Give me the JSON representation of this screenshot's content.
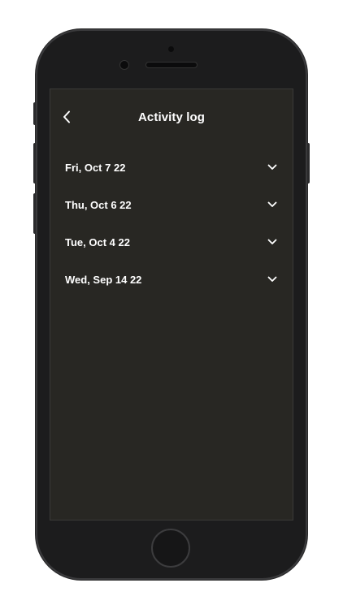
{
  "header": {
    "title": "Activity log",
    "back_icon": "chevron-left-icon"
  },
  "log": {
    "items": [
      {
        "date": "Fri, Oct 7 22",
        "icon": "chevron-down-icon"
      },
      {
        "date": "Thu, Oct 6 22",
        "icon": "chevron-down-icon"
      },
      {
        "date": "Tue, Oct 4 22",
        "icon": "chevron-down-icon"
      },
      {
        "date": "Wed, Sep 14 22",
        "icon": "chevron-down-icon"
      }
    ]
  },
  "colors": {
    "screen_background": "#282723",
    "text": "#ffffff",
    "device_frame": "#1c1c1d"
  }
}
